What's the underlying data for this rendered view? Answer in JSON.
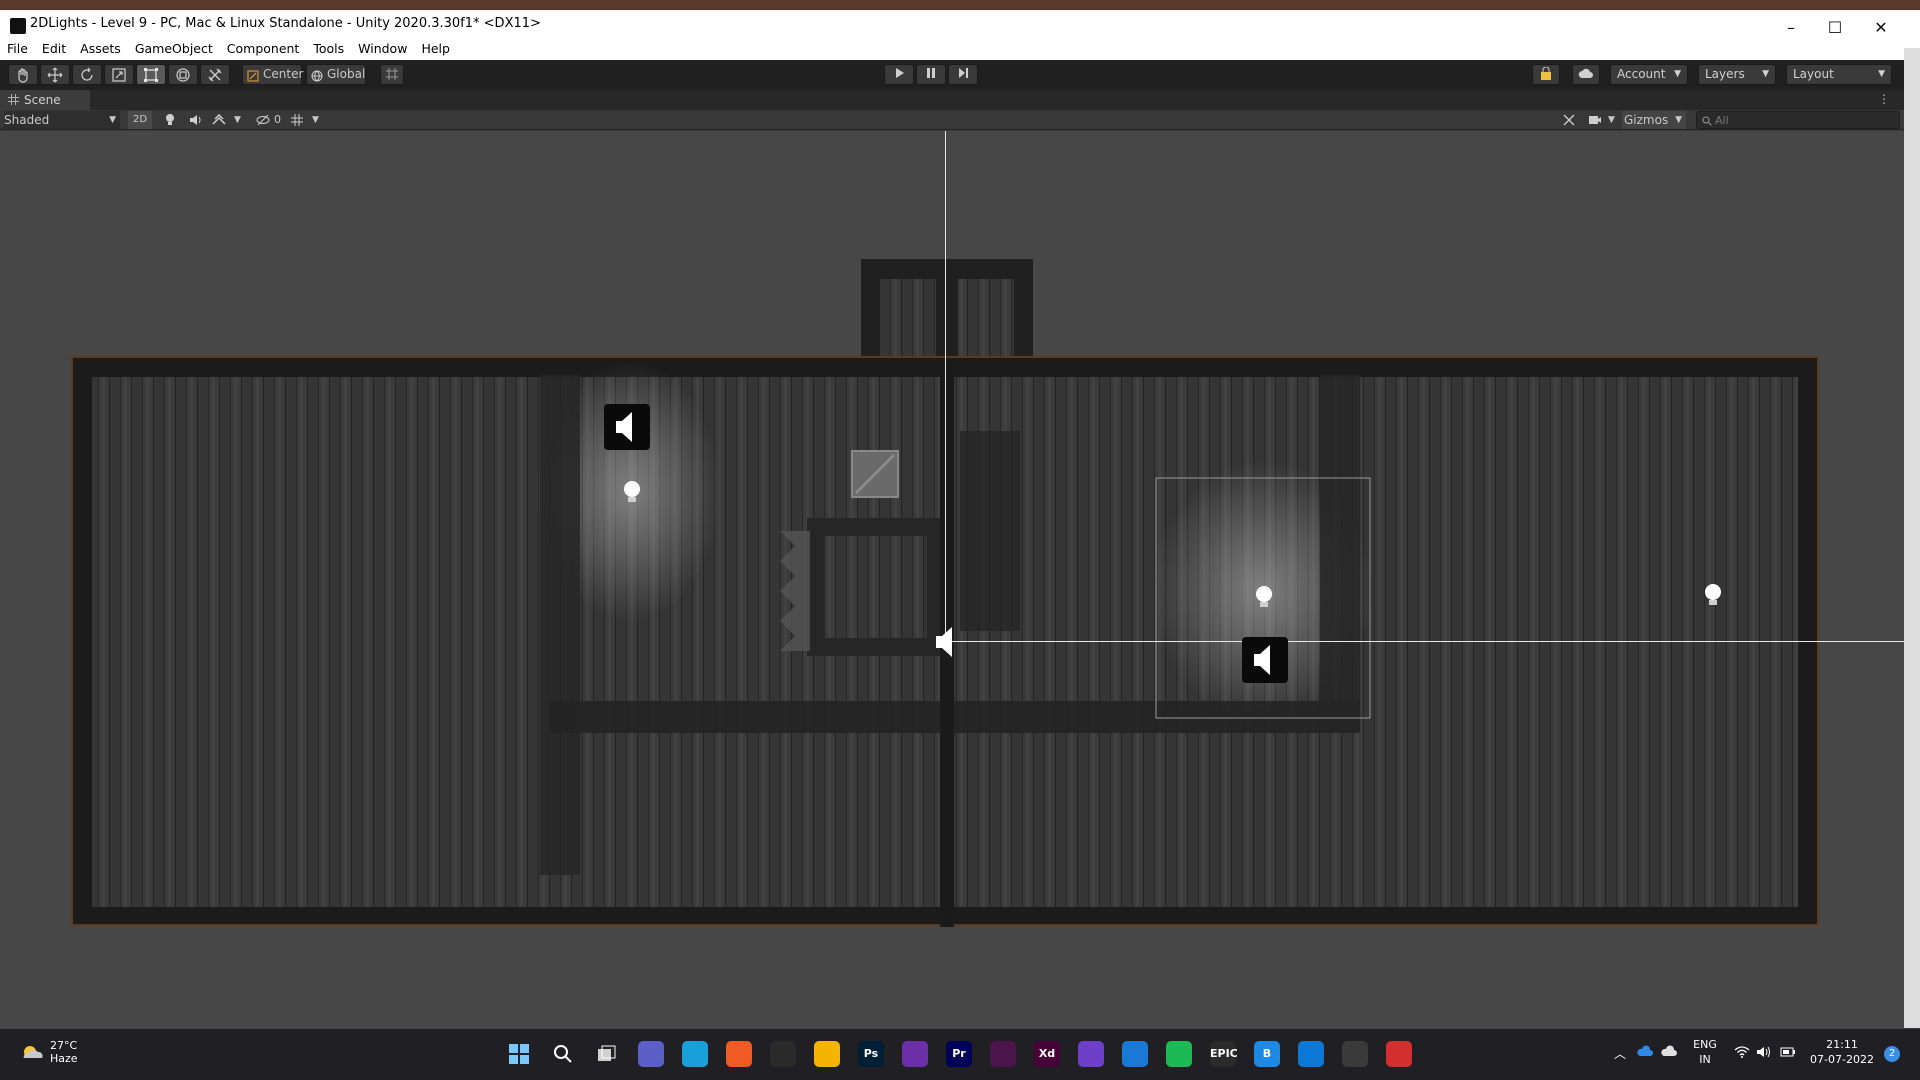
{
  "window": {
    "title": "2DLights - Level 9 - PC, Mac & Linux Standalone - Unity 2020.3.30f1* <DX11>",
    "minimize": "–",
    "maximize": "☐",
    "close": "✕"
  },
  "menu": [
    "File",
    "Edit",
    "Assets",
    "GameObject",
    "Component",
    "Tools",
    "Window",
    "Help"
  ],
  "toolbar": {
    "pivot_label": "Center",
    "space_label": "Global",
    "account_label": "Account",
    "layers_label": "Layers",
    "layout_label": "Layout"
  },
  "scene": {
    "tab_label": "Scene",
    "shading_mode": "Shaded",
    "mode_2d": "2D",
    "hidden_count": "0",
    "gizmos_label": "Gizmos",
    "search_placeholder": "All"
  },
  "taskbar": {
    "temperature": "27°C",
    "weather": "Haze",
    "language": "ENG",
    "region": "IN",
    "time": "21:11",
    "date": "07-07-2022",
    "notification_count": "2",
    "apps": [
      {
        "name": "windows-start",
        "label": "",
        "color": "#1a8ce6"
      },
      {
        "name": "search",
        "label": "",
        "color": "#1f1f24"
      },
      {
        "name": "task-view",
        "label": "",
        "color": "#1f1f24"
      },
      {
        "name": "teams-chat",
        "label": "",
        "color": "#5b5fc7"
      },
      {
        "name": "edge",
        "label": "",
        "color": "#1a9fd8"
      },
      {
        "name": "brave",
        "label": "",
        "color": "#f05a24"
      },
      {
        "name": "unity-hub",
        "label": "",
        "color": "#2a2a2a"
      },
      {
        "name": "file-explorer",
        "label": "",
        "color": "#f4b400"
      },
      {
        "name": "photoshop",
        "label": "Ps",
        "color": "#001e36"
      },
      {
        "name": "visual-studio",
        "label": "",
        "color": "#6b2fa8"
      },
      {
        "name": "premiere",
        "label": "Pr",
        "color": "#00005b"
      },
      {
        "name": "slack",
        "label": "",
        "color": "#4a154b"
      },
      {
        "name": "adobe-xd",
        "label": "Xd",
        "color": "#470137"
      },
      {
        "name": "github",
        "label": "",
        "color": "#6e40c9"
      },
      {
        "name": "mail",
        "label": "",
        "color": "#1a78d6"
      },
      {
        "name": "spotify",
        "label": "",
        "color": "#1db954"
      },
      {
        "name": "epic-games",
        "label": "EPIC",
        "color": "#2a2a2a"
      },
      {
        "name": "blue-app",
        "label": "B",
        "color": "#1e88e5"
      },
      {
        "name": "vscode",
        "label": "",
        "color": "#0a78d4"
      },
      {
        "name": "unity",
        "label": "",
        "color": "#3a3a3a"
      },
      {
        "name": "snipping-tool",
        "label": "",
        "color": "#d32f2f"
      }
    ]
  }
}
